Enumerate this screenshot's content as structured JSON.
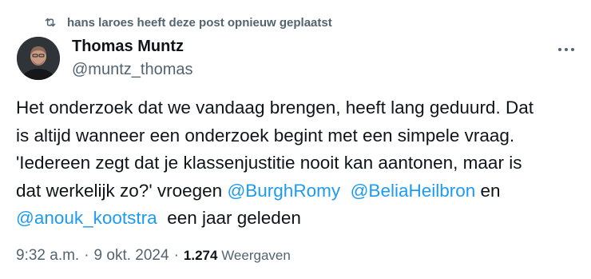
{
  "repost": {
    "text": "hans laroes heeft deze post opnieuw geplaatst",
    "icon": "repost-icon"
  },
  "author": {
    "name": "Thomas Muntz",
    "handle": "@muntz_thomas"
  },
  "more_icon": "more-icon",
  "tweet": {
    "line1": "Het onderzoek dat we vandaag brengen, heeft lang geduurd. Dat",
    "line2": "is altijd wanneer een onderzoek begint met een simpele vraag.",
    "line3": "'Iedereen zegt dat je klassenjustitie nooit kan aantonen, maar is",
    "line4_text": "dat werkelijk zo?' vroegen ",
    "mention1": "@BurghRomy",
    "mention2": "@BeliaHeilbron",
    "line4_tail": " en",
    "mention3": "@anouk_kootstra",
    "line5_tail": "  een jaar geleden"
  },
  "meta": {
    "time": "9:32 a.m.",
    "dot1": "·",
    "date": "9 okt. 2024",
    "dot2": "·",
    "views_count": "1.274",
    "views_label": "Weergaven"
  },
  "colors": {
    "text": "#0f1419",
    "secondary": "#536471",
    "link": "#1d9bf0"
  }
}
